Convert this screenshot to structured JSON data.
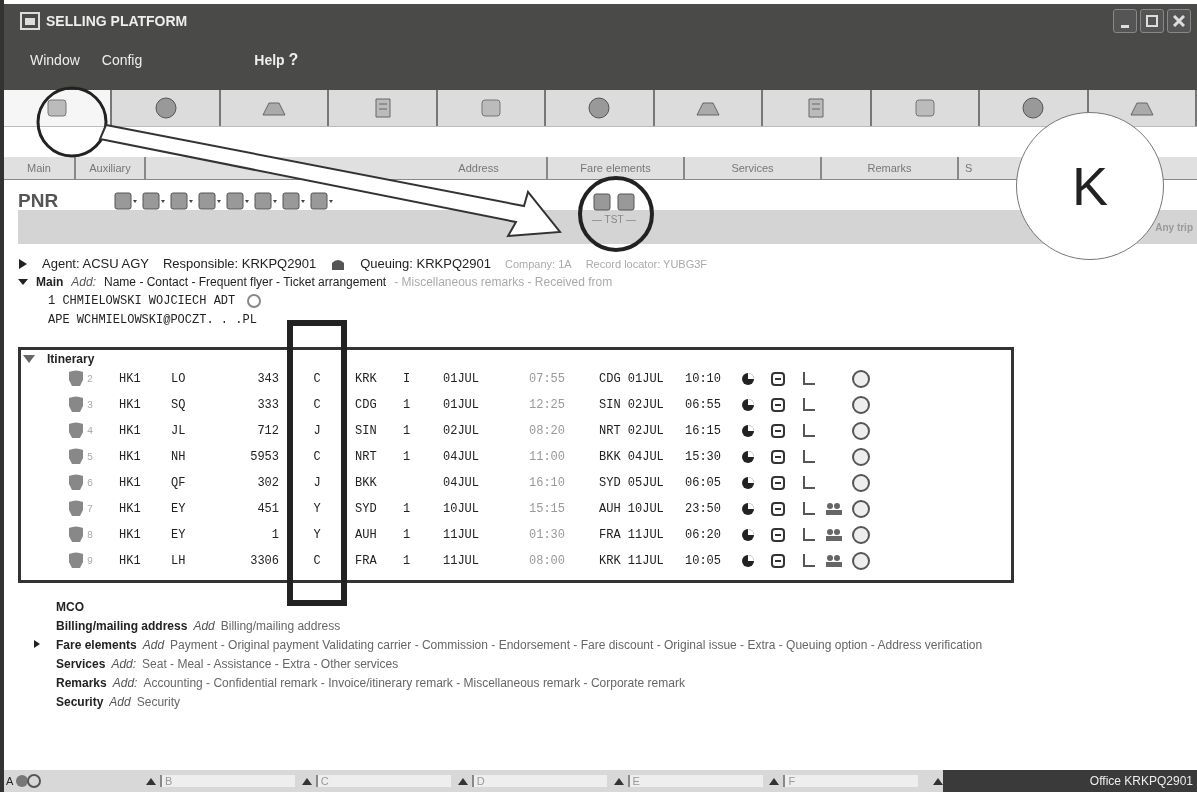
{
  "window": {
    "title": "SELLING PLATFORM"
  },
  "menu": [
    {
      "label": "Window"
    },
    {
      "label": "Config"
    },
    {
      "label": "Help",
      "help_mark": "?"
    }
  ],
  "tool_tabs": [
    {
      "selected": true
    },
    {
      "selected": false
    },
    {
      "selected": false
    },
    {
      "selected": false
    },
    {
      "selected": false
    },
    {
      "selected": false
    },
    {
      "selected": false
    },
    {
      "selected": false
    },
    {
      "selected": false
    },
    {
      "selected": false
    },
    {
      "selected": false
    }
  ],
  "sub_tabs": [
    {
      "label": "Main"
    },
    {
      "label": "Auxiliary"
    },
    {
      "label": "Address"
    },
    {
      "label": "Fare elements"
    },
    {
      "label": "Services"
    },
    {
      "label": "Remarks"
    },
    {
      "label": "S"
    }
  ],
  "pnr": {
    "title": "PNR",
    "tst_label": "— TST —",
    "any_trip": "Any trip",
    "agent_line": {
      "agent": "Agent: ACSU AGY",
      "responsible": "Responsible: KRKPQ2901",
      "queuing": "Queuing: KRKPQ2901",
      "company": "Company: 1A",
      "locator": "Record locator: YUBG3F"
    },
    "main": {
      "title": "Main",
      "add": "Add:",
      "items": "Name - Contact - Frequent flyer - Ticket arrangement",
      "faded_items": "- Miscellaneous remarks - Received from",
      "expanded": true
    },
    "name_lines": [
      "  1 CHMIELOWSKI WOJCIECH  ADT",
      "APE WCHMIELOWSKI@POCZT.  .  .PL"
    ]
  },
  "itinerary": {
    "title": "Itinerary",
    "rows": [
      {
        "seg": "2",
        "status": "HK1",
        "airline": "LO",
        "flight": "343",
        "class": "C",
        "from": "KRK",
        "term": "I",
        "date": "01JUL",
        "dep": "07:55",
        "to": "CDG 01JUL",
        "arr": "10:10",
        "group_icon": false
      },
      {
        "seg": "3",
        "status": "HK1",
        "airline": "SQ",
        "flight": "333",
        "class": "C",
        "from": "CDG",
        "term": "1",
        "date": "01JUL",
        "dep": "12:25",
        "to": "SIN 02JUL",
        "arr": "06:55",
        "group_icon": false
      },
      {
        "seg": "4",
        "status": "HK1",
        "airline": "JL",
        "flight": "712",
        "class": "J",
        "from": "SIN",
        "term": "1",
        "date": "02JUL",
        "dep": "08:20",
        "to": "NRT 02JUL",
        "arr": "16:15",
        "group_icon": false
      },
      {
        "seg": "5",
        "status": "HK1",
        "airline": "NH",
        "flight": "5953",
        "class": "C",
        "from": "NRT",
        "term": "1",
        "date": "04JUL",
        "dep": "11:00",
        "to": "BKK 04JUL",
        "arr": "15:30",
        "group_icon": false
      },
      {
        "seg": "6",
        "status": "HK1",
        "airline": "QF",
        "flight": "302",
        "class": "J",
        "from": "BKK",
        "date": "04JUL",
        "dep": "16:10",
        "to": "SYD 05JUL",
        "arr": "06:05",
        "group_icon": false
      },
      {
        "seg": "7",
        "status": "HK1",
        "airline": "EY",
        "flight": "451",
        "class": "Y",
        "from": "SYD",
        "term": "1",
        "date": "10JUL",
        "dep": "15:15",
        "to": "AUH 10JUL",
        "arr": "23:50",
        "group_icon": true
      },
      {
        "seg": "8",
        "status": "HK1",
        "airline": "EY",
        "flight": "1",
        "class": "Y",
        "from": "AUH",
        "term": "1",
        "date": "11JUL",
        "dep": "01:30",
        "to": "FRA 11JUL",
        "arr": "06:20",
        "group_icon": true
      },
      {
        "seg": "9",
        "status": "HK1",
        "airline": "LH",
        "flight": "3306",
        "class": "C",
        "from": "FRA",
        "term": "1",
        "date": "11JUL",
        "dep": "08:00",
        "to": "KRK 11JUL",
        "arr": "10:05",
        "group_icon": true
      }
    ]
  },
  "sections": [
    {
      "title": "MCO",
      "expandable": false
    },
    {
      "title": "Billing/mailing address",
      "add": "Add",
      "items": "Billing/mailing address",
      "expandable": false
    },
    {
      "title": "Fare elements",
      "add": "Add",
      "items": "Payment - Original payment   Validating carrier - Commission - Endorsement - Fare discount - Original issue - Extra - Queuing option - Address verification",
      "expandable": true
    },
    {
      "title": "Services",
      "add": "Add:",
      "items": "Seat - Meal - Assistance - Extra - Other services",
      "expandable": false
    },
    {
      "title": "Remarks",
      "add": "Add:",
      "items": "Accounting - Confidential remark - Invoice/itinerary remark - Miscellaneous remark - Corporate remark",
      "expandable": false
    },
    {
      "title": "Security",
      "add": "Add",
      "items": "Security",
      "expandable": false
    }
  ],
  "status_bar": {
    "lead": "A",
    "fields": [
      "B",
      "C",
      "D",
      "E",
      "F"
    ],
    "office": "Office  KRKPQ2901"
  },
  "callout": {
    "label": "K"
  }
}
